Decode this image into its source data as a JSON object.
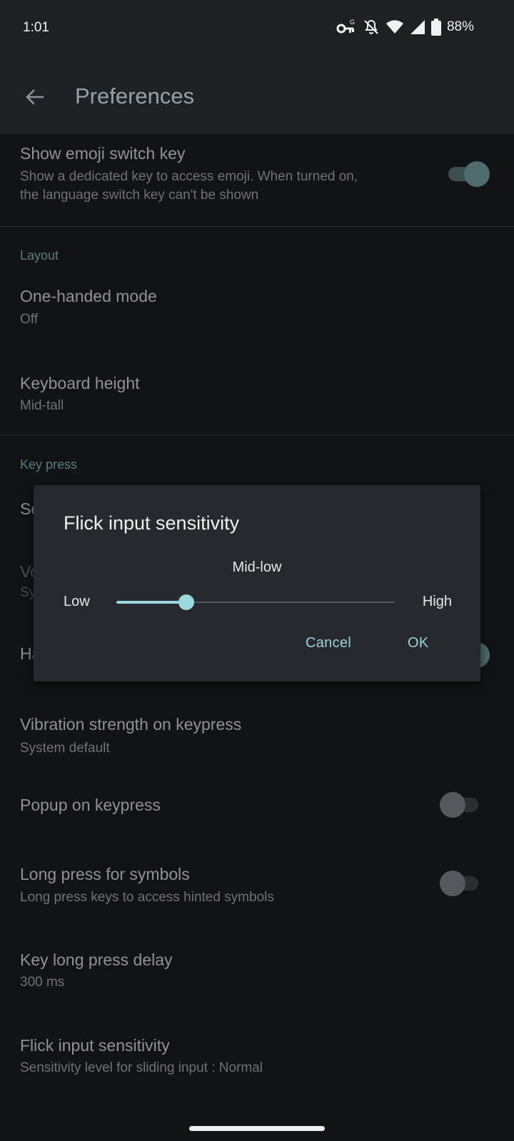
{
  "status_bar": {
    "time": "1:01",
    "battery": "88%",
    "icons": [
      "vpn-key-icon",
      "bell-off-icon",
      "wifi-icon",
      "signal-icon",
      "battery-icon"
    ]
  },
  "app_bar": {
    "title": "Preferences",
    "back_icon": "arrow-left-icon"
  },
  "list": {
    "emoji": {
      "title": "Show emoji switch key",
      "subtitle_line1": "Show a dedicated key to access emoji. When turned on,",
      "subtitle_line2": "the language switch key can't be shown",
      "toggle": true
    },
    "section_layout": "Layout",
    "one_handed": {
      "title": "One-handed mode",
      "subtitle": "Off"
    },
    "keyboard_height": {
      "title": "Keyboard height",
      "subtitle": "Mid-tall"
    },
    "section_keypress": "Key press",
    "partial_sound": {
      "title_fragment": "So"
    },
    "partial_volume": {
      "title_fragment": "Vo",
      "subtitle_fragment": "Sy"
    },
    "partial_haptic": {
      "title_fragment": "Ha",
      "toggle": true
    },
    "vibration": {
      "title": "Vibration strength on keypress",
      "subtitle": "System default"
    },
    "popup": {
      "title": "Popup on keypress",
      "toggle": false
    },
    "long_press_symbols": {
      "title": "Long press for symbols",
      "subtitle": "Long press keys to access hinted symbols",
      "toggle": false
    },
    "long_press_delay": {
      "title": "Key long press delay",
      "subtitle": "300 ms"
    },
    "flick_sensitivity": {
      "title": "Flick input sensitivity",
      "subtitle": "Sensitivity level for sliding input : Normal"
    }
  },
  "dialog": {
    "title": "Flick input sensitivity",
    "current_value": "Mid-low",
    "min_label": "Low",
    "max_label": "High",
    "slider_fraction": 0.25,
    "cancel": "Cancel",
    "ok": "OK"
  },
  "colors": {
    "accent": "#9ad9e0",
    "background": "#111315",
    "dialog": "#26292d"
  }
}
